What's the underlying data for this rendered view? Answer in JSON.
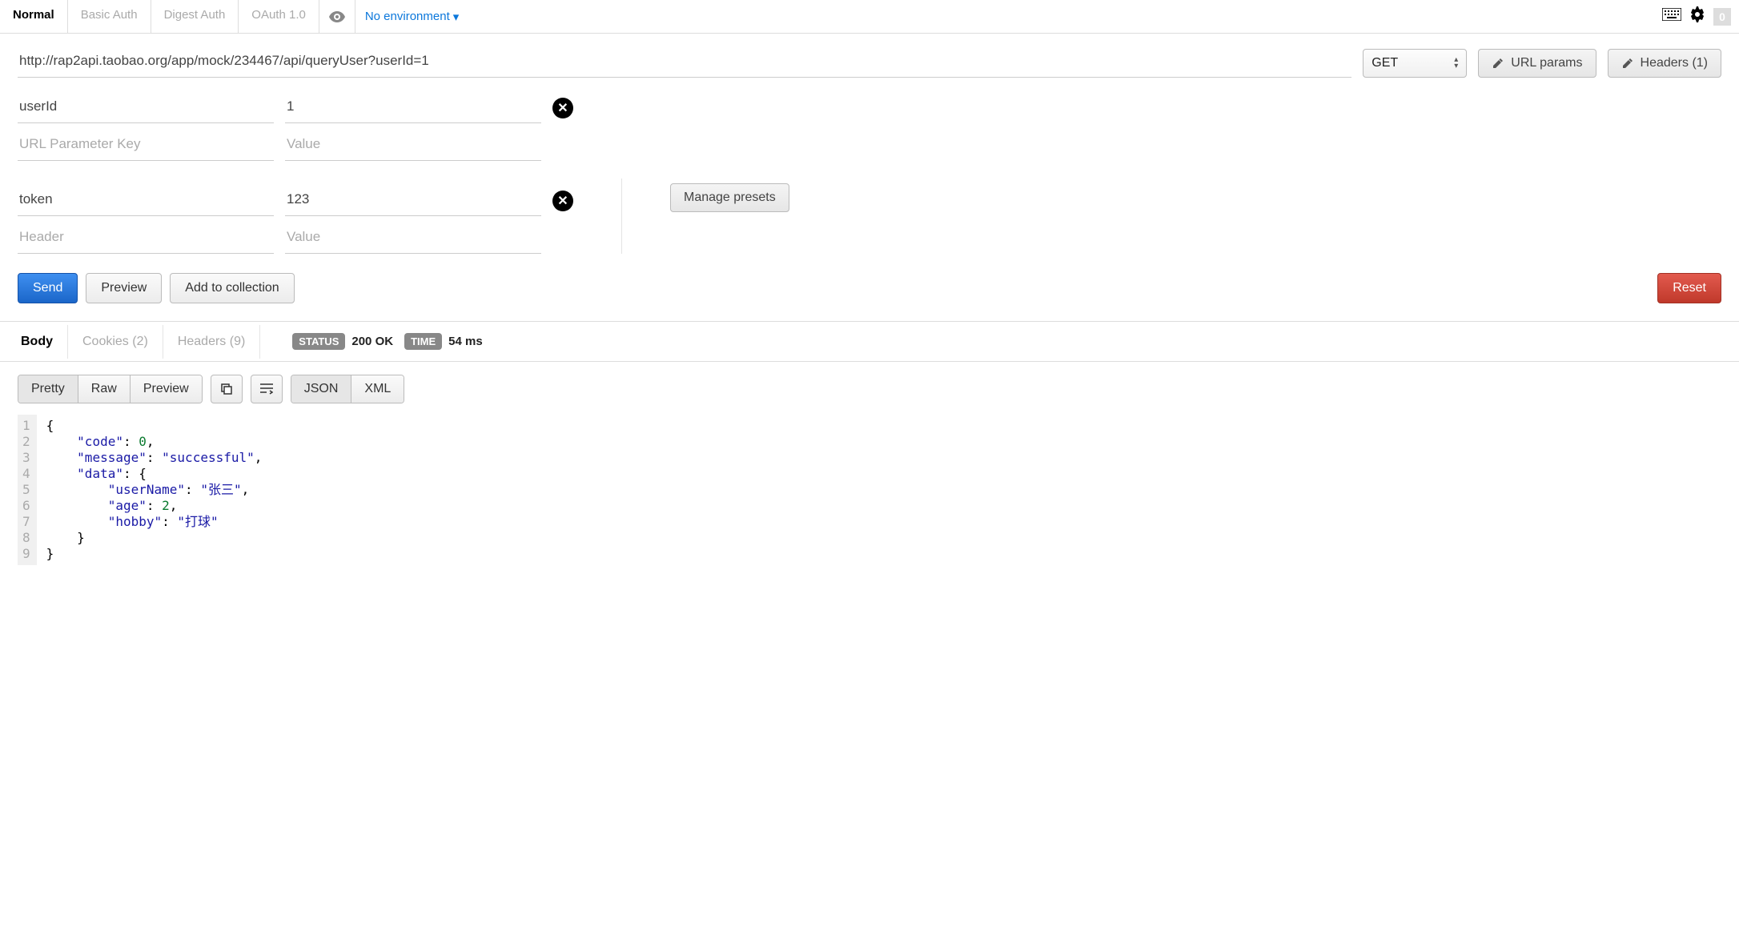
{
  "topbar": {
    "auth_tabs": [
      "Normal",
      "Basic Auth",
      "Digest Auth",
      "OAuth 1.0"
    ],
    "active_auth_tab_index": 0,
    "environment_label": "No environment",
    "badge_zero": "0"
  },
  "request": {
    "url": "http://rap2api.taobao.org/app/mock/234467/api/queryUser?userId=1",
    "method": "GET",
    "url_params_button": "URL params",
    "headers_button": "Headers (1)",
    "url_params": [
      {
        "key": "userId",
        "value": "1"
      }
    ],
    "url_param_key_placeholder": "URL Parameter Key",
    "url_param_value_placeholder": "Value",
    "headers": [
      {
        "key": "token",
        "value": "123"
      }
    ],
    "header_key_placeholder": "Header",
    "header_value_placeholder": "Value",
    "manage_presets_label": "Manage presets"
  },
  "actions": {
    "send": "Send",
    "preview": "Preview",
    "add_to_collection": "Add to collection",
    "reset": "Reset"
  },
  "response": {
    "tabs": {
      "body": "Body",
      "cookies": "Cookies (2)",
      "headers": "Headers (9)"
    },
    "active_tab": "body",
    "status_label": "STATUS",
    "status_value": "200 OK",
    "time_label": "TIME",
    "time_value": "54 ms",
    "view_modes": {
      "pretty": "Pretty",
      "raw": "Raw",
      "preview": "Preview"
    },
    "active_view_mode": "pretty",
    "format_modes": {
      "json": "JSON",
      "xml": "XML"
    },
    "active_format_mode": "json",
    "body_json": {
      "code": 0,
      "message": "successful",
      "data": {
        "userName": "张三",
        "age": 2,
        "hobby": "打球"
      }
    },
    "line_count": 9
  }
}
